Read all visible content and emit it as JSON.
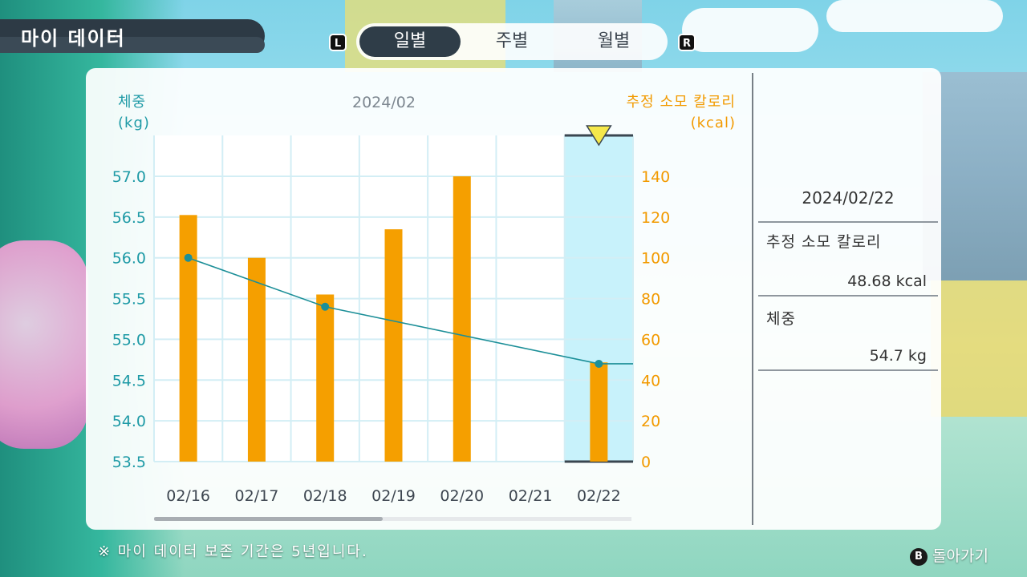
{
  "header": {
    "title": "마이 데이터",
    "left_key": "L",
    "right_key": "R",
    "tabs": [
      {
        "label": "일별",
        "active": true
      },
      {
        "label": "주별",
        "active": false
      },
      {
        "label": "월별",
        "active": false
      }
    ]
  },
  "chart": {
    "month_label": "2024/02",
    "left_axis_title": [
      "체중",
      "(kg)"
    ],
    "right_axis_title": [
      "추정 소모 칼로리",
      "(kcal)"
    ],
    "selected_index": 6
  },
  "chart_data": {
    "type": "bar",
    "categories": [
      "02/16",
      "02/17",
      "02/18",
      "02/19",
      "02/20",
      "02/21",
      "02/22"
    ],
    "series": [
      {
        "name": "추정 소모 칼로리",
        "axis": "right",
        "type": "bar",
        "values": [
          121,
          100,
          82,
          114,
          140,
          null,
          48.68
        ]
      },
      {
        "name": "체중",
        "axis": "left",
        "type": "line",
        "values": [
          56.0,
          null,
          55.4,
          null,
          null,
          null,
          54.7
        ]
      }
    ],
    "y_left": {
      "min": 53.5,
      "max": 57.0,
      "ticks": [
        "53.5",
        "54.0",
        "54.5",
        "55.0",
        "55.5",
        "56.0",
        "56.5",
        "57.0"
      ],
      "color": "#1e9aa6"
    },
    "y_right": {
      "min": 0,
      "max": 140,
      "ticks": [
        "0",
        "20",
        "40",
        "60",
        "80",
        "100",
        "120",
        "140"
      ],
      "color": "#f29a00"
    },
    "bar_color": "#f59f00",
    "line_color": "#1c8f98",
    "highlight_color": "#c8f2fb"
  },
  "detail": {
    "date": "2024/02/22",
    "calorie_label": "추정 소모 칼로리",
    "calorie_value": "48.68 kcal",
    "weight_label": "체중",
    "weight_value": "54.7  kg"
  },
  "footer": {
    "note": "※ 마이 데이터 보존 기간은 5년입니다.",
    "back_key": "B",
    "back_label": "돌아가기"
  },
  "scrollbar": {
    "position": 0.48
  }
}
